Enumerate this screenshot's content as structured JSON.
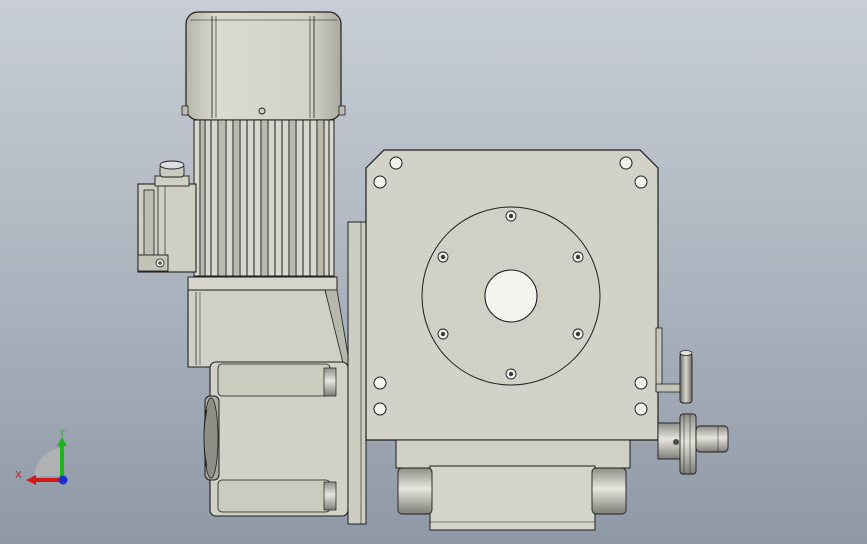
{
  "viewport": {
    "background_top": "#c9ced6",
    "background_bottom": "#8f98a5"
  },
  "part_colors": {
    "body": "#cfcfc4",
    "body_shade": "#b8b8ac",
    "edge": "#1e1e1e",
    "hole": "#f2f2ee",
    "dark_cap": "#6e6e6a"
  },
  "triad": {
    "x_label": "X",
    "y_label": "Y",
    "x_color": "#d01818",
    "y_color": "#18b818",
    "z_color": "#1a2fd0"
  }
}
